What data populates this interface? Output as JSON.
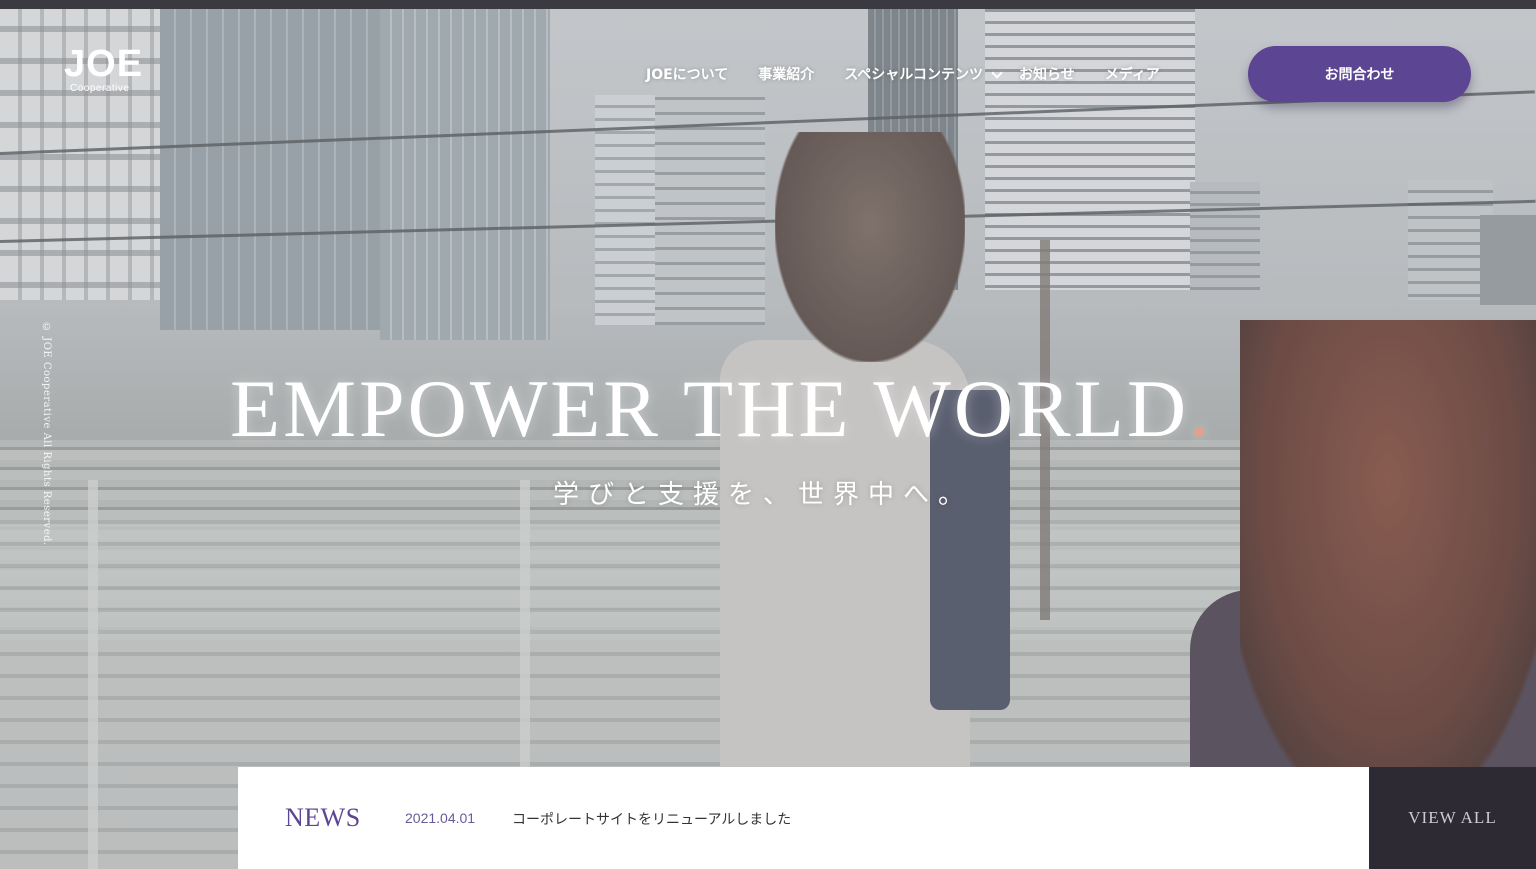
{
  "header": {
    "logo_text": "JOE",
    "logo_sub": "Cooperative",
    "nav": {
      "about": "JOEについて",
      "business": "事業紹介",
      "special": "スペシャルコンテンツ",
      "news": "お知らせ",
      "media": "メディア"
    },
    "contact_label": "お問合わせ"
  },
  "hero": {
    "copyright": "© JOE Cooperative All Rights Reserved.",
    "headline": "EMPOWER THE WORLD",
    "headline_dot": ".",
    "subline": "学びと支援を、世界中へ。"
  },
  "news": {
    "label": "NEWS",
    "date": "2021.04.01",
    "title": "コーポレートサイトをリニューアルしました",
    "view_all": "VIEW ALL"
  },
  "colors": {
    "accent": "#5c4592",
    "dark_panel": "#2e2a33",
    "headline_dot": "#e3a18a"
  }
}
